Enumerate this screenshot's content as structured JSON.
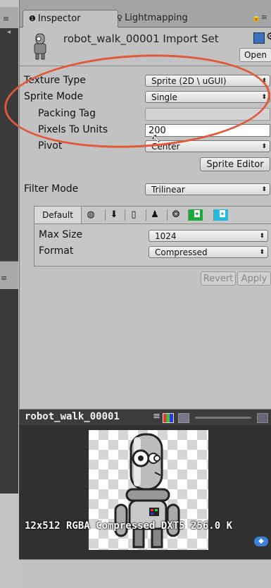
{
  "tabs": {
    "inspector": "Inspector",
    "lightmapping": "Lightmapping"
  },
  "header": {
    "title": "robot_walk_00001 Import Set",
    "open_label": "Open"
  },
  "fields": {
    "texture_type_label": "Texture Type",
    "texture_type_value": "Sprite (2D \\ uGUI)",
    "sprite_mode_label": "Sprite Mode",
    "sprite_mode_value": "Single",
    "packing_tag_label": "Packing Tag",
    "packing_tag_value": "",
    "pixels_to_units_label": "Pixels To Units",
    "pixels_to_units_value": "200",
    "pivot_label": "Pivot",
    "pivot_value": "Center",
    "sprite_editor_label": "Sprite Editor",
    "filter_mode_label": "Filter Mode",
    "filter_mode_value": "Trilinear"
  },
  "platform": {
    "default_label": "Default",
    "icons": [
      "web-icon",
      "download-icon",
      "mobile-icon",
      "android-icon",
      "blackberry-icon",
      "windows-store-icon",
      "windows-store-alt-icon"
    ],
    "max_size_label": "Max Size",
    "max_size_value": "1024",
    "format_label": "Format",
    "format_value": "Compressed"
  },
  "actions": {
    "revert": "Revert",
    "apply": "Apply"
  },
  "preview": {
    "title": "robot_walk_00001",
    "info": "12x512  RGBA Compressed DXT5   256.0 K"
  },
  "colors": {
    "annotation": "#e05a3a",
    "panel_bg": "#c2c2c2",
    "preview_bg": "#303030"
  }
}
